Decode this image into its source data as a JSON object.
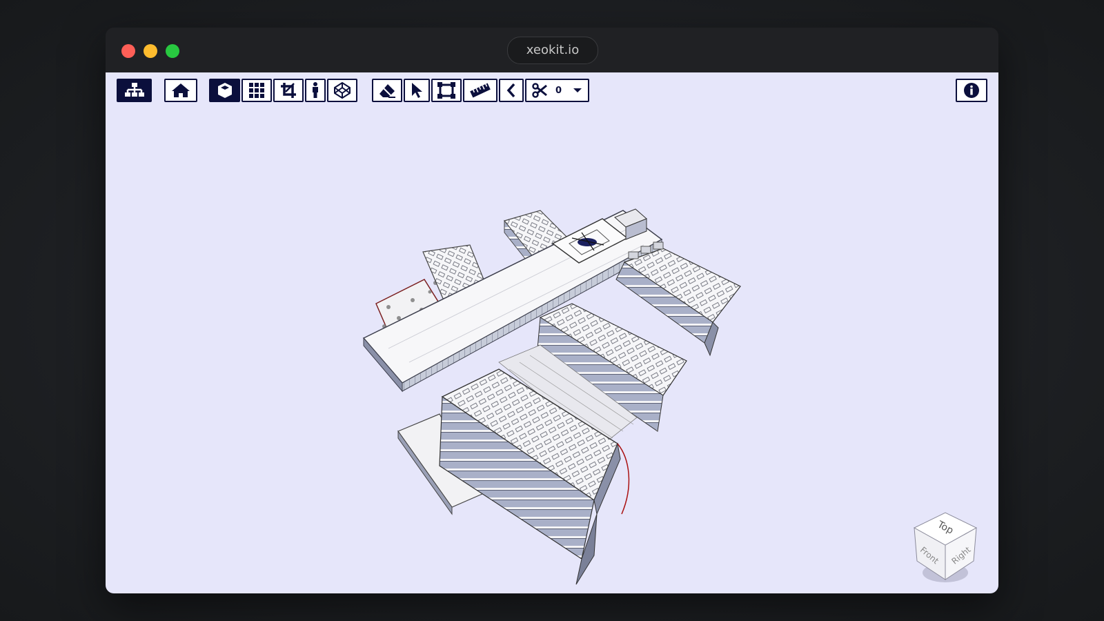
{
  "window": {
    "url": "xeokit.io",
    "controls": [
      "close",
      "minimize",
      "maximize"
    ]
  },
  "toolbar": {
    "groups": [
      [
        {
          "icon": "sitemap-icon",
          "label": "Explorer",
          "active": true
        }
      ],
      [
        {
          "icon": "home-icon",
          "label": "Reset view",
          "active": false
        }
      ],
      [
        {
          "icon": "cube-icon",
          "label": "3D mode",
          "active": true
        },
        {
          "icon": "grid-icon",
          "label": "Toggle spaces",
          "active": false
        },
        {
          "icon": "crop-icon",
          "label": "Fit view",
          "active": false
        },
        {
          "icon": "person-icon",
          "label": "First person mode",
          "active": false
        },
        {
          "icon": "codepen-icon",
          "label": "X-ray",
          "active": false
        }
      ],
      [
        {
          "icon": "eraser-icon",
          "label": "Hide objects",
          "active": false
        },
        {
          "icon": "pointer-icon",
          "label": "Select objects",
          "active": false
        },
        {
          "icon": "object-ungroup-icon",
          "label": "Marquee select",
          "active": false
        },
        {
          "icon": "ruler-icon",
          "label": "Measure distance",
          "active": false
        },
        {
          "icon": "chevron-left-icon",
          "label": "Measure angle",
          "active": false
        }
      ]
    ],
    "section_tool": {
      "icon": "scissors-icon",
      "count": "0",
      "dropdown_icon": "caret-down-icon"
    },
    "info_icon": "info-circle-icon"
  },
  "nav_cube": {
    "faces": {
      "top": "Top",
      "front": "Front",
      "right": "Right"
    }
  },
  "colors": {
    "viewer_bg": "#e6e6fa",
    "toolbar_accent": "#0b0f3c",
    "titlebar": "#202124"
  }
}
